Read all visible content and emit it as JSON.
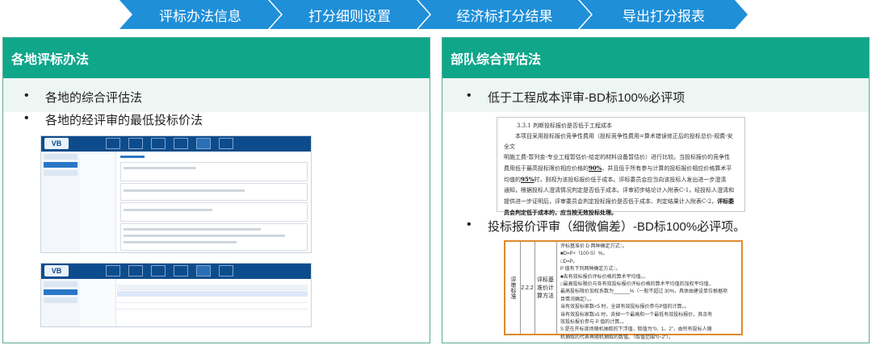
{
  "steps": [
    "评标办法信息",
    "打分细则设置",
    "经济标打分结果",
    "导出打分报表"
  ],
  "left": {
    "title": "各地评标办法",
    "bullets": [
      "各地的综合评估法",
      "各地的经评审的最低投标价法"
    ],
    "app_logo": "VB"
  },
  "right": {
    "title": "部队综合评估法",
    "bullets": [
      "低于工程成本评审-BD标100%必评项",
      "投标报价评审（细微偏差）-BD标100%必评项。"
    ],
    "doc": {
      "heading": "3.3.1  判断投标报价是否低于工程成本",
      "lines": [
        "本项目采用投标报价竞争性费用（投标竞争性费用=算术错误修正后的投标总价-规费-安全文",
        "明施工费-暂列金-专业工程暂估价-给定的材料设备暂估价）进行比较。当投标报价的竞争性",
        "费用低于最高投标限价相应价格的",
        "，并且低于所有参与计算的投标报价相应价格算术平",
        "均值的",
        "时，则视为该投标报价低于成本。评标委员会应当向该投标人发出进一步澄清",
        "通知，根据投标人澄清情况判定是否低于成本。评审初步结论计入附表C-1，经投标人澄清和",
        "提供进一步证明后，评审委员会判定投标报价是否低于成本、判定结果计入附表C-2，",
        "评标委",
        "员会判定低于成本的，应当按无效投标处理。"
      ],
      "pct1": "90%",
      "pct2": "95%"
    },
    "table": {
      "col1": "评审标准",
      "col2": "2.2.2",
      "col3": "评标基准价计算方法",
      "lines": [
        "评标基准价 D 两种确定方式：。",
        "■D=P×（100-S）%。",
        "□D=P。",
        "P 值有下列两种确定方式：。",
        "■去有效标报价评标价格的算术平均值。。",
        "□最高投标限价与各有效投标报价评标价格的算术平均值的加权平均值，",
        "最高投标限价加权系数为______%（一般不超过 30%，具体由建设单位根据项",
        "目情况确定）。。",
        "当有效投标家数<5 时，全部有效投标报价参与P值的计算。。",
        "当有效投标家数≥5 时，去掉一个最高和一个最低有效投标报价，其余有",
        "效投标报价参与 P 值的计算。。",
        "S 是在开标现场随机抽取的下浮值，取值为“0、1、2”，由所有投标人随",
        "机抽取的代表再随机抽取的数值。（取值范围“0~2”）。"
      ]
    }
  },
  "colors": {
    "step": "#1f8fd8",
    "panel_head": "#0fa68a",
    "highlight": "#e08a2b"
  }
}
